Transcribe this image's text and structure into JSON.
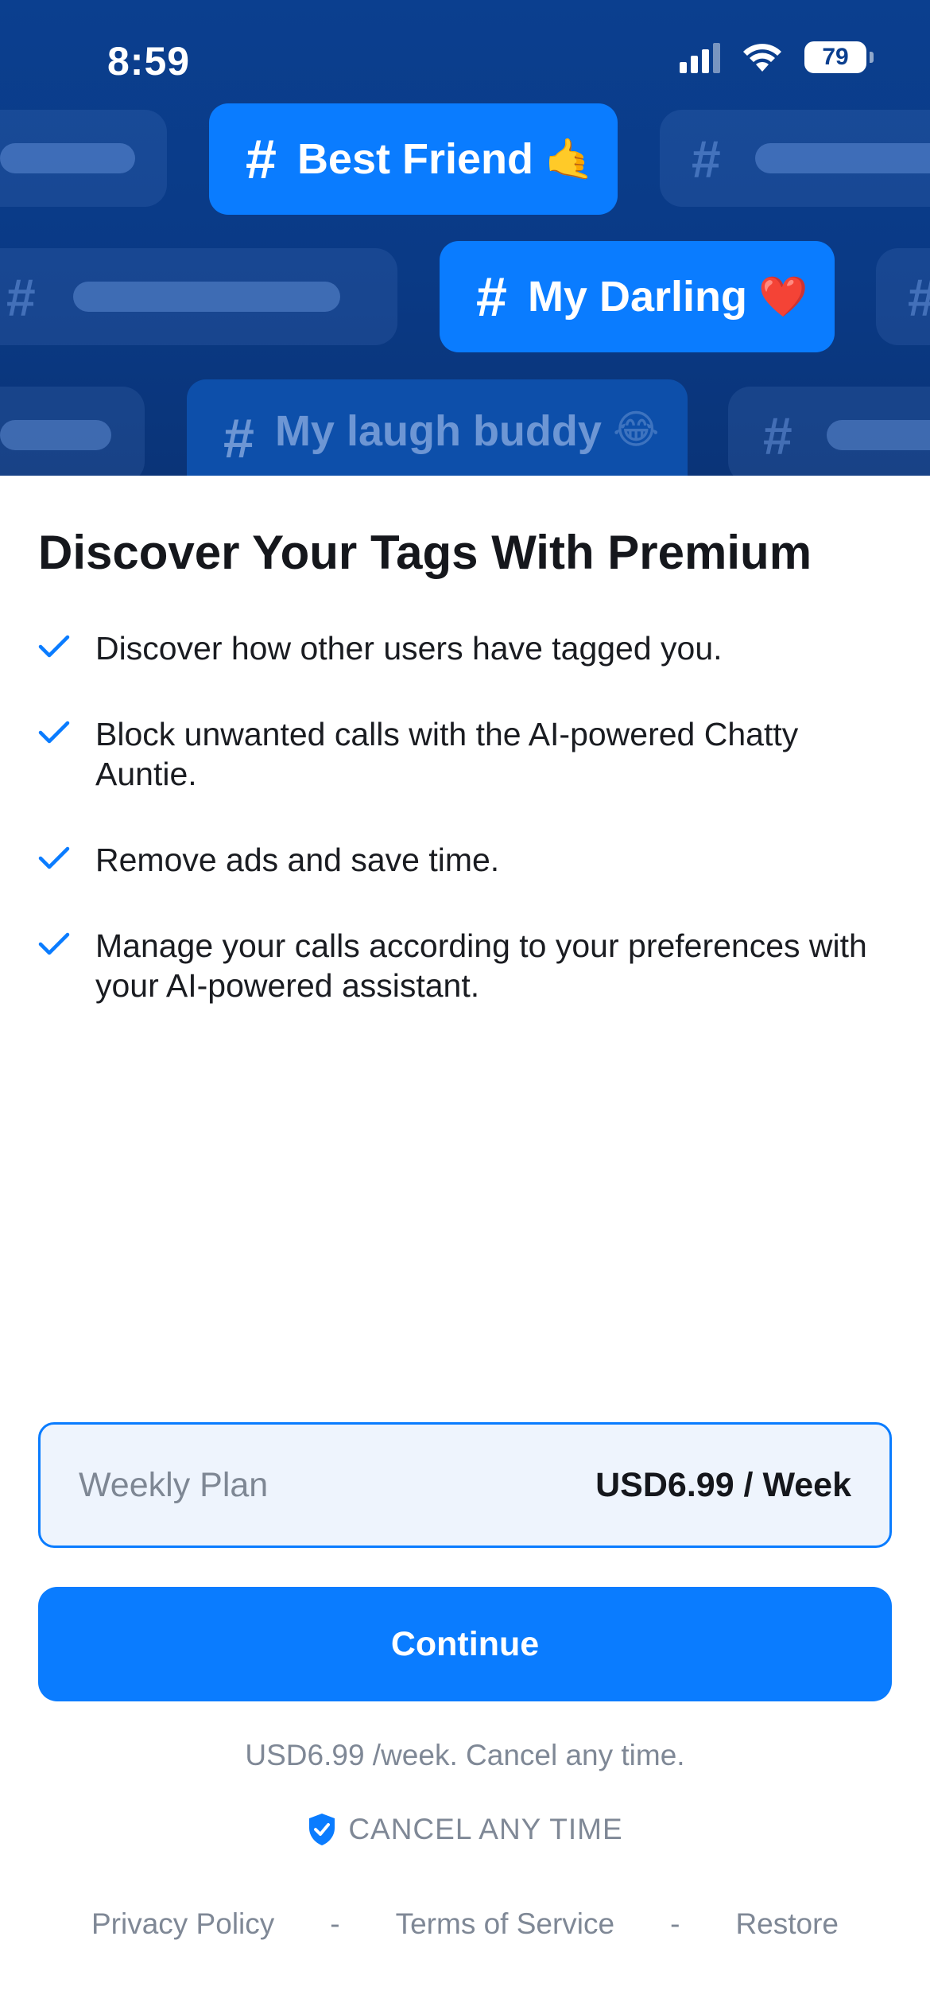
{
  "status_bar": {
    "time": "8:59",
    "battery": "79"
  },
  "hero": {
    "tags": [
      {
        "label": "Best Friend",
        "emoji": "🤙"
      },
      {
        "label": "My Darling",
        "emoji": "❤️"
      },
      {
        "label": "My laugh buddy",
        "emoji": "😂"
      }
    ],
    "hash_symbol": "#"
  },
  "title": "Discover Your Tags With Premium",
  "features": [
    "Discover how other users have tagged you.",
    "Block unwanted calls with the AI-powered Chatty Auntie.",
    "Remove ads and save time.",
    "Manage your calls according to your preferences with your AI-powered assistant."
  ],
  "plan": {
    "name": "Weekly Plan",
    "price": "USD6.99 / Week"
  },
  "continue_label": "Continue",
  "price_note": "USD6.99 /week. Cancel any time.",
  "cancel_badge": "CANCEL ANY TIME",
  "footer": {
    "privacy": "Privacy Policy",
    "terms": "Terms of Service",
    "restore": "Restore",
    "separator": "-"
  },
  "colors": {
    "accent": "#0a7cff",
    "hero_bg": "#0b3f8f",
    "muted_text": "#7f8896"
  },
  "icons": {
    "feature_bullet": "checkmark-icon",
    "cancel_badge": "shield-check-icon"
  }
}
